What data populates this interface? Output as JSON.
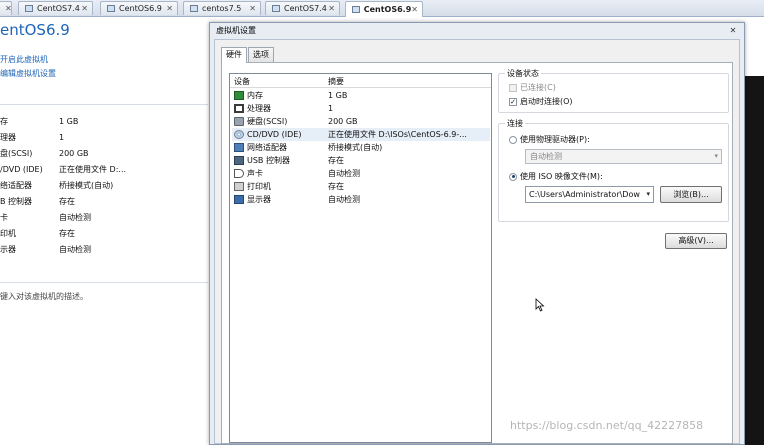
{
  "tabs": [
    {
      "label": "CentOS7.4"
    },
    {
      "label": "CentOS6.9"
    },
    {
      "label": "centos7.5"
    },
    {
      "label": "CentOS7.4"
    },
    {
      "label": "CentOS6.9"
    }
  ],
  "left_panel": {
    "title": "entOS6.9",
    "actions": [
      "开启此虚拟机",
      "编辑虚拟机设置"
    ],
    "summary": [
      {
        "k": "存",
        "v": "1 GB"
      },
      {
        "k": "理器",
        "v": "1"
      },
      {
        "k": "盘(SCSI)",
        "v": "200 GB"
      },
      {
        "k": "/DVD (IDE)",
        "v": "正在使用文件 D:..."
      },
      {
        "k": "络适配器",
        "v": "桥接模式(自动)"
      },
      {
        "k": "B 控制器",
        "v": "存在"
      },
      {
        "k": "卡",
        "v": "自动检测"
      },
      {
        "k": "印机",
        "v": "存在"
      },
      {
        "k": "示器",
        "v": "自动检测"
      }
    ],
    "description": "键入对该虚拟机的描述。"
  },
  "dialog": {
    "title": "虚拟机设置",
    "close_glyph": "✕",
    "tabs": [
      "硬件",
      "选项"
    ],
    "device_list": {
      "col_device": "设备",
      "col_summary": "摘要",
      "rows": [
        {
          "icon": "memory-icon",
          "name": "内存",
          "value": "1 GB"
        },
        {
          "icon": "processor-icon",
          "name": "处理器",
          "value": "1"
        },
        {
          "icon": "hard-disk-icon",
          "name": "硬盘(SCSI)",
          "value": "200 GB"
        },
        {
          "icon": "cd-dvd-icon",
          "name": "CD/DVD (IDE)",
          "value": "正在使用文件 D:\\ISOs\\CentOS-6.9-..."
        },
        {
          "icon": "network-adapter-icon",
          "name": "网络适配器",
          "value": "桥接模式(自动)"
        },
        {
          "icon": "usb-controller-icon",
          "name": "USB 控制器",
          "value": "存在"
        },
        {
          "icon": "sound-card-icon",
          "name": "声卡",
          "value": "自动检测"
        },
        {
          "icon": "printer-icon",
          "name": "打印机",
          "value": "存在"
        },
        {
          "icon": "display-icon",
          "name": "显示器",
          "value": "自动检测"
        }
      ],
      "selected_index": 3
    },
    "device_status": {
      "title": "设备状态",
      "connected_label": "已连接(C)",
      "connect_at_power_on_label": "启动时连接(O)",
      "connected": false,
      "connect_at_power_on": true
    },
    "connection": {
      "title": "连接",
      "physical_label": "使用物理驱动器(P):",
      "physical_value": "自动检测",
      "iso_label": "使用 ISO 映像文件(M):",
      "iso_path": "C:\\Users\\Administrator\\Dow",
      "browse_label": "浏览(B)...",
      "selected": "iso"
    },
    "advanced_label": "高级(V)..."
  },
  "watermark": "https://blog.csdn.net/qq_42227858"
}
